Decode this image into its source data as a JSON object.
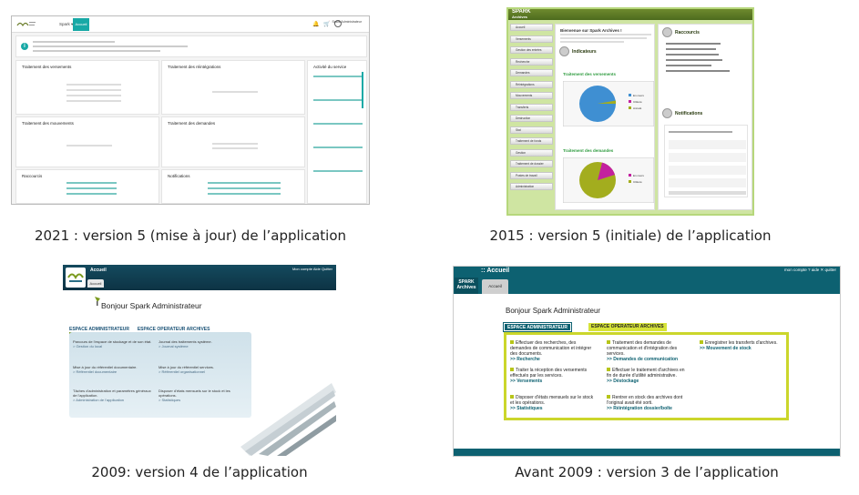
{
  "captions": {
    "c2021": "2021 : version 5 (mise à jour) de l’application",
    "c2015": "2015 : version 5 (initiale) de l’application",
    "c2009": "2009: version 4 de l’application",
    "cavant": "Avant 2009 : version 3 de l’application"
  },
  "v2021": {
    "tab": "Spark ▾",
    "accueil": "Accueil",
    "user": "Spark Administrateur",
    "panels": {
      "versements": "Traitement des versements",
      "reintegrations": "Traitement des réintégrations",
      "activite": "Activité du service",
      "mouvements": "Traitement des mouvements",
      "demandes": "Traitement des demandes",
      "raccourcis": "Raccourcis",
      "notifications": "Notifications"
    }
  },
  "v2015": {
    "logo_line1": "SPARK",
    "logo_line2": "Archives",
    "menu": [
      "Accueil",
      "Versements",
      "Gestion des entrées",
      "Recherche",
      "Demandes",
      "Réintégrations",
      "Mouvements",
      "Transferts",
      "Destruction",
      "Stat",
      "Traitement de fonds",
      "Gestion",
      "Traitement de dossier",
      "Postes de travail",
      "Administration"
    ],
    "welcome": "Bienvenue sur Spark Archives !",
    "indicateurs": "Indicateurs",
    "chart1_title": "Traitement des versements",
    "chart2_title": "Traitement des demandes",
    "raccourcis": "Raccourcis",
    "notifications": "Notifications",
    "colors": {
      "blue": "#3f8fd2",
      "olive": "#a3ad1e",
      "magenta": "#c3219f"
    },
    "legend1": [
      "En cours",
      "Clôturé",
      "Annulé"
    ],
    "legend2": [
      "En cours",
      "Clôturé"
    ]
  },
  "v2009": {
    "header": "Accueil",
    "subtab": "Accueil",
    "topright": "Mon compte   Aide   Quitter",
    "hello": "Bonjour Spark Administrateur",
    "tab_admin": "ESPACE ADMINISTRATEUR",
    "tab_op": "ESPACE OPERATEUR ARCHIVES",
    "items": [
      {
        "text": "Parcours de l'espace de stockage et de son état.",
        "link": "> Gestion du local"
      },
      {
        "text": "Journal des traitements système.",
        "link": "> Journal système"
      },
      {
        "text": "Mise à jour du référentiel documentaire.",
        "link": "> Référentiel documentaire"
      },
      {
        "text": "Mise à jour du référentiel services.",
        "link": "> Référentiel organisationnel"
      },
      {
        "text": "Tâches d'administration et paramètres généraux de l'application.",
        "link": "> Administration de l'application"
      },
      {
        "text": "Disposer d'états mensuels sur le stock et les opérations.",
        "link": "> Statistiques"
      }
    ]
  },
  "vavant": {
    "title": ":: Accueil",
    "logo": "SPARK Archives",
    "tab": "Accueil",
    "topright": "mon compte   ? aide   ✕ quitter",
    "hello": "Bonjour Spark Administrateur",
    "tab_admin": "ESPACE ADMINISTRATEUR",
    "tab_op": "ESPACE OPERATEUR ARCHIVES",
    "items": [
      {
        "text": "Effectuer des recherches, des demandes de communication et intégrer des documents.",
        "link": ">> Recherche"
      },
      {
        "text": "Traitement des demandes de communication et d'intégration des services.",
        "link": ">> Demandes de communication"
      },
      {
        "text": "Enregistrer les transferts d'archives.",
        "link": ">> Mouvement de stock"
      },
      {
        "text": "Traiter la réception des versements effectués par les services.",
        "link": ">> Versements"
      },
      {
        "text": "Effectuer le traitement d'archives en fin de durée d'utilité administrative.",
        "link": ">> Déstockage"
      },
      {
        "text": "Disposer d'états mensuels sur le stock et les opérations.",
        "link": ">> Statistiques"
      },
      {
        "text": "Rentrer en stock des archives dont l'original avait été sorti.",
        "link": ">> Réintégration dossier/boîte"
      }
    ]
  }
}
